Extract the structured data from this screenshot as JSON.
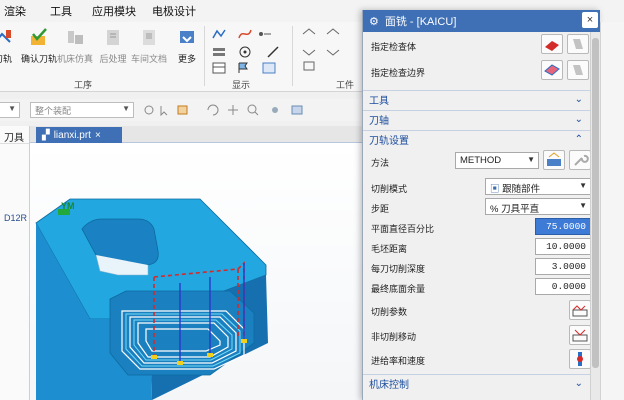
{
  "menubar": {
    "items": [
      "渲染",
      "工具",
      "应用模块",
      "电极设计"
    ]
  },
  "ribbon": {
    "btn_daogui": "刀轨",
    "btn_confirm": "确认刀轨",
    "btn_sim": "机床仿真",
    "btn_post": "后处理",
    "btn_shop": "车间文档",
    "btn_more": "更多",
    "group_process": "工序",
    "group_display": "显示",
    "group_tool": "工件"
  },
  "toolbar2": {
    "combo1_placeholder": "整个装配"
  },
  "side": {
    "header": "刀具",
    "cell": "D12R"
  },
  "viewport": {
    "tab_name": "lianxi.prt",
    "axis_label": "YM"
  },
  "dialog": {
    "title": "面铣 - [KAICU]",
    "rows": {
      "check_body": "指定检查体",
      "check_boundary": "指定检查边界"
    },
    "sections": {
      "tool": "工具",
      "axis": "刀轴",
      "path_settings": "刀轨设置",
      "machine_control": "机床控制"
    },
    "method_label": "方法",
    "method_value": "METHOD",
    "cut_mode_label": "切削模式",
    "cut_mode_value": "跟随部件",
    "stepover_label": "步距",
    "stepover_value": "% 刀具平直",
    "flat_percent_label": "平面直径百分比",
    "flat_percent_value": "75.0000",
    "blank_distance_label": "毛坯距离",
    "blank_distance_value": "10.0000",
    "depth_per_cut_label": "每刀切削深度",
    "depth_per_cut_value": "3.0000",
    "floor_stock_label": "最终底面余量",
    "floor_stock_value": "0.0000",
    "cut_params_label": "切削参数",
    "non_cut_moves_label": "非切削移动",
    "feeds_speeds_label": "进给率和速度"
  }
}
